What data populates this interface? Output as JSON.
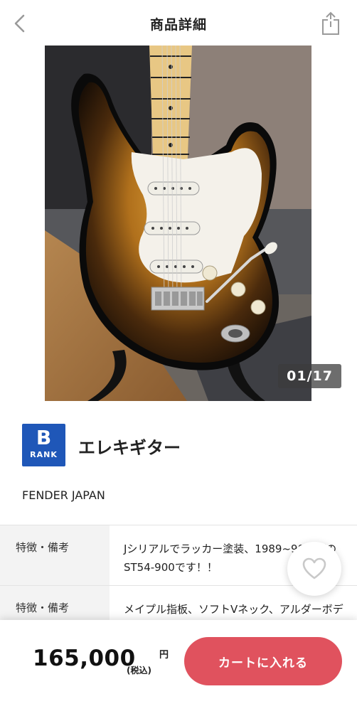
{
  "header": {
    "title": "商品詳細",
    "back_icon": "chevron-left-icon",
    "share_icon": "share-icon"
  },
  "gallery": {
    "counter": "01/17"
  },
  "product": {
    "rank_letter": "B",
    "rank_label": "RANK",
    "rank_color": "#1f57b8",
    "name": "エレキギター",
    "brand": "FENDER JAPAN"
  },
  "specs": [
    {
      "label": "特徴・備考",
      "value": "Jシリアルでラッカー塗装、1989~90年頃のST54-900です！！"
    },
    {
      "label": "特徴・備考",
      "value": "メイプル指板、ソフトVネック、アルダーボディ、U字ピックアップ"
    }
  ],
  "bottom": {
    "price": "165,000",
    "currency": "円",
    "tax_note": "(税込)",
    "cart_button": "カートに入れる",
    "accent_color": "#e0525e"
  }
}
